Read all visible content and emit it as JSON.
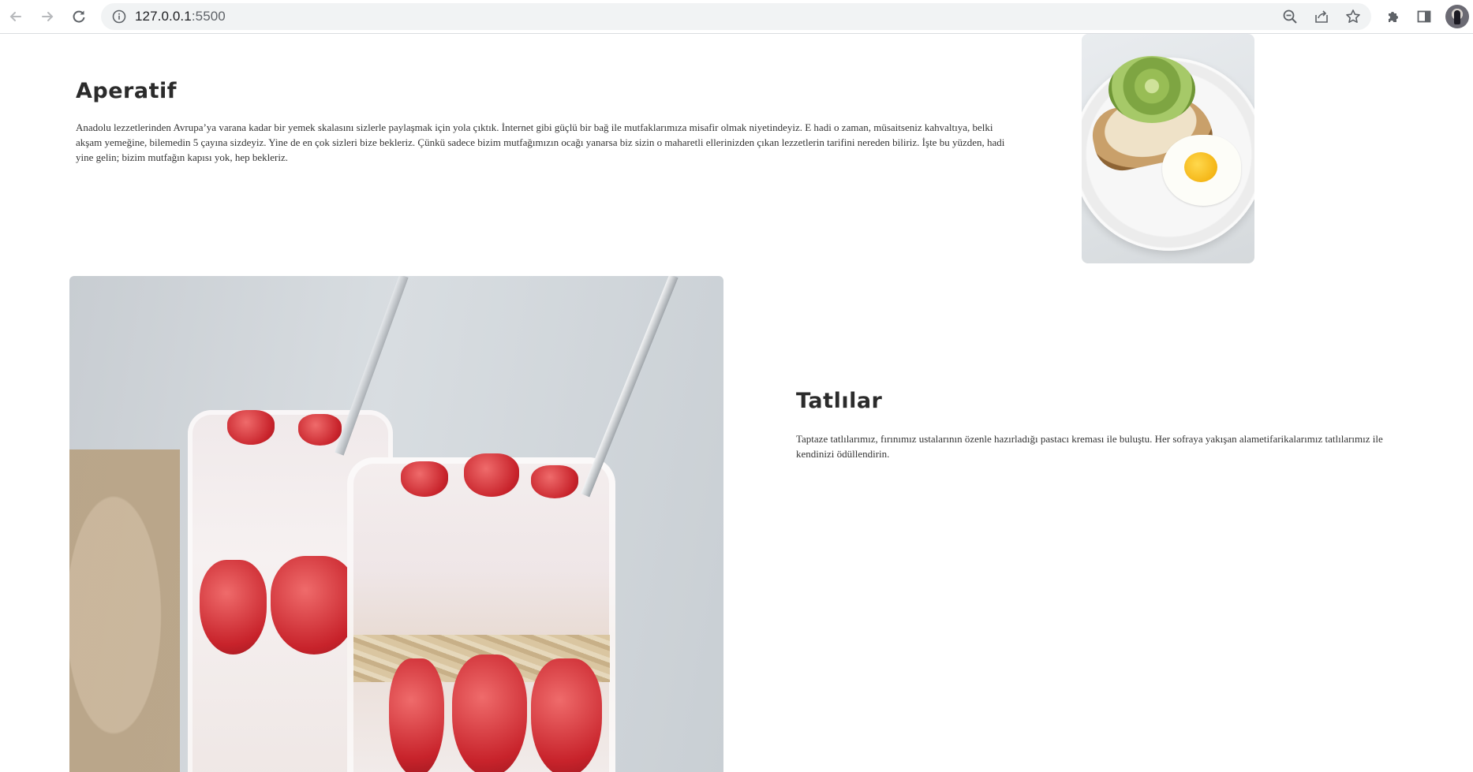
{
  "browser": {
    "url_host": "127.0.0.1",
    "url_port": ":5500"
  },
  "sections": [
    {
      "title": "Aperatif",
      "text": "Anadolu lezzetlerinden Avrupa’ya varana kadar bir yemek skalasını sizlerle paylaşmak için yola çıktık. İnternet gibi güçlü bir bağ ile mutfaklarımıza misafir olmak niyetindeyiz. E hadi o zaman, müsaitseniz kahvaltıya, belki akşam yemeğine, bilemedin 5 çayına sizdeyiz. Yine de en çok sizleri bize bekleriz. Çünkü sadece bizim mutfağımızın ocağı yanarsa biz sizin o maharetli ellerinizden çıkan lezzetlerin tarifini nereden biliriz. İşte bu yüzden, hadi yine gelin; bizim mutfağın kapısı yok, hep bekleriz."
    },
    {
      "title": "Tatlılar",
      "text": "Taptaze tatlılarımız, fırınımız ustalarının özenle hazırladığı pastacı kreması ile buluştu. Her sofraya yakışan alametifarikalarımız tatlılarımız ile kendinizi ödüllendirin."
    }
  ]
}
